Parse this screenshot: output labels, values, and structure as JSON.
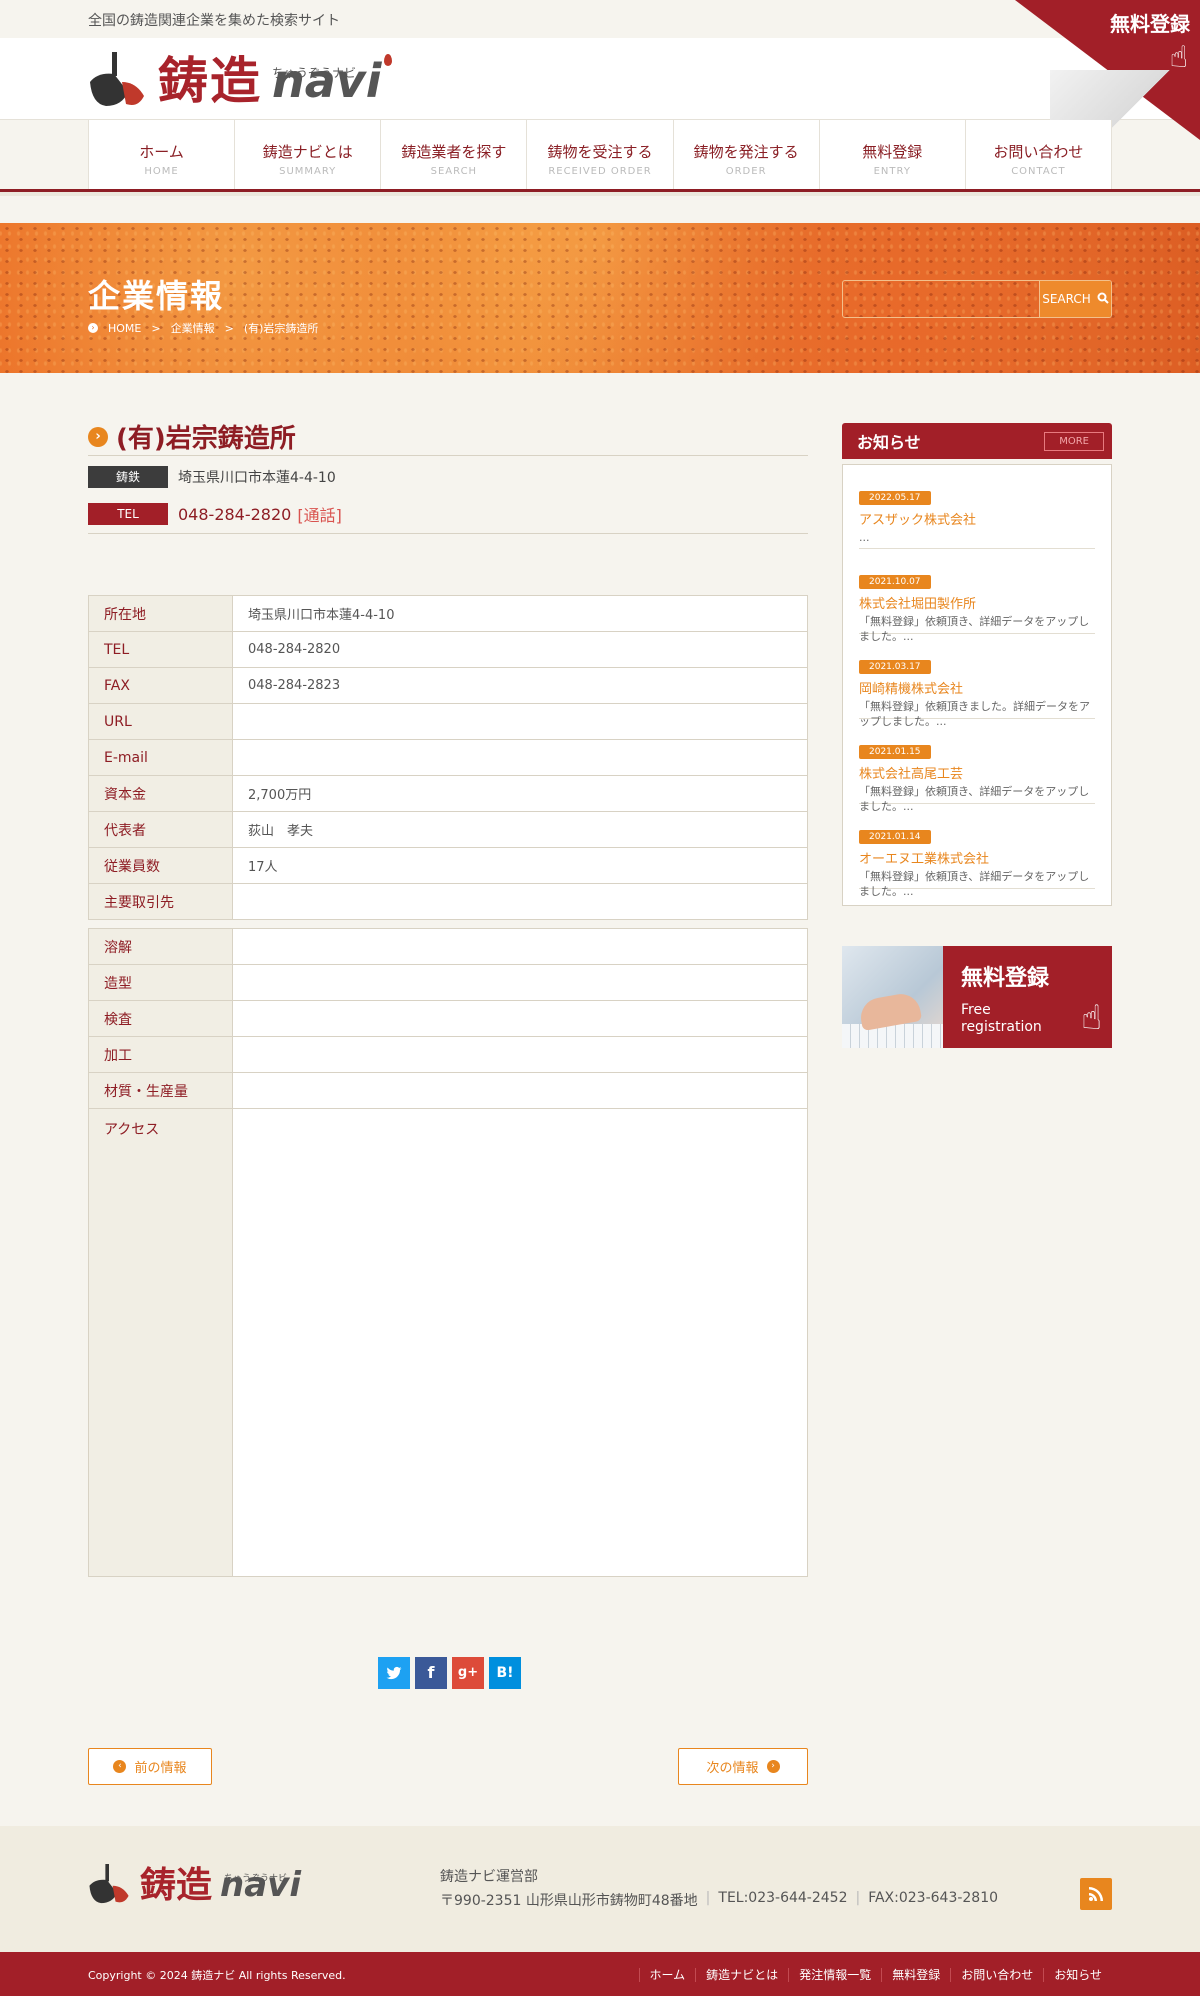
{
  "header": {
    "tagline": "全国の鋳造関連企業を集めた検索サイト",
    "logo_kanji": "鋳造",
    "logo_navi": "navi",
    "logo_kana": "ちゅうぞうナビ",
    "corner_label": "無料登録"
  },
  "nav": [
    {
      "jp": "ホーム",
      "en": "HOME"
    },
    {
      "jp": "鋳造ナビとは",
      "en": "SUMMARY"
    },
    {
      "jp": "鋳造業者を探す",
      "en": "SEARCH"
    },
    {
      "jp": "鋳物を受注する",
      "en": "RECEIVED ORDER"
    },
    {
      "jp": "鋳物を発注する",
      "en": "ORDER"
    },
    {
      "jp": "無料登録",
      "en": "ENTRY"
    },
    {
      "jp": "お問い合わせ",
      "en": "CONTACT"
    }
  ],
  "hero": {
    "title": "企業情報",
    "breadcrumb": [
      "HOME",
      ">",
      "企業情報",
      ">",
      "(有)岩宗鋳造所"
    ],
    "search_placeholder": "",
    "search_button": "SEARCH"
  },
  "company": {
    "name": "(有)岩宗鋳造所",
    "category": "鋳鉄",
    "address": "埼玉県川口市本蓮4-4-10",
    "tel_badge": "TEL",
    "tel": "048-284-2820",
    "call_label": "[通話]"
  },
  "table1": [
    {
      "key": "所在地",
      "value": "埼玉県川口市本蓮4-4-10"
    },
    {
      "key": "TEL",
      "value": "048-284-2820"
    },
    {
      "key": "FAX",
      "value": "048-284-2823"
    },
    {
      "key": "URL",
      "value": ""
    },
    {
      "key": "E-mail",
      "value": ""
    },
    {
      "key": "資本金",
      "value": "2,700万円"
    },
    {
      "key": "代表者",
      "value": "荻山　孝夫"
    },
    {
      "key": "従業員数",
      "value": "17人"
    },
    {
      "key": "主要取引先",
      "value": ""
    }
  ],
  "table2": [
    {
      "key": "溶解",
      "value": ""
    },
    {
      "key": "造型",
      "value": ""
    },
    {
      "key": "検査",
      "value": ""
    },
    {
      "key": "加工",
      "value": ""
    },
    {
      "key": "材質・生産量",
      "value": ""
    },
    {
      "key": "アクセス",
      "value": ""
    }
  ],
  "social": [
    "twitter-icon",
    "facebook-icon",
    "google-plus-icon",
    "hatena-bookmark-icon"
  ],
  "pager": {
    "prev": "前の情報",
    "next": "次の情報"
  },
  "sidebar": {
    "news_title": "お知らせ",
    "more": "MORE",
    "news": [
      {
        "date": "2022.05.17",
        "title": "アスザック株式会社",
        "desc": "..."
      },
      {
        "date": "2021.10.07",
        "title": "株式会社堀田製作所",
        "desc": "「無料登録」依頼頂き、詳細データをアップしました。..."
      },
      {
        "date": "2021.03.17",
        "title": "岡崎精機株式会社",
        "desc": "「無料登録」依頼頂きました。詳細データをアップしました。..."
      },
      {
        "date": "2021.01.15",
        "title": "株式会社高尾工芸",
        "desc": "「無料登録」依頼頂き、詳細データをアップしました。..."
      },
      {
        "date": "2021.01.14",
        "title": "オーエヌ工業株式会社",
        "desc": "「無料登録」依頼頂き、詳細データをアップしました。..."
      }
    ],
    "banner_jp": "無料登録",
    "banner_en1": "Free",
    "banner_en2": "registration"
  },
  "footer": {
    "org": "鋳造ナビ運営部",
    "address": "〒990-2351 山形県山形市鋳物町48番地",
    "tel": "TEL:023-644-2452",
    "fax": "FAX:023-643-2810",
    "copyright_prefix": "Copyright © 2024 ",
    "copyright_brand": "鋳造ナビ",
    "copyright_suffix": " All rights Reserved.",
    "links": [
      "ホーム",
      "鋳造ナビとは",
      "発注情報一覧",
      "無料登録",
      "お問い合わせ",
      "お知らせ"
    ]
  },
  "colors": {
    "brand_red": "#a21f28",
    "accent_orange": "#e8861e",
    "background": "#f6f4ee"
  }
}
